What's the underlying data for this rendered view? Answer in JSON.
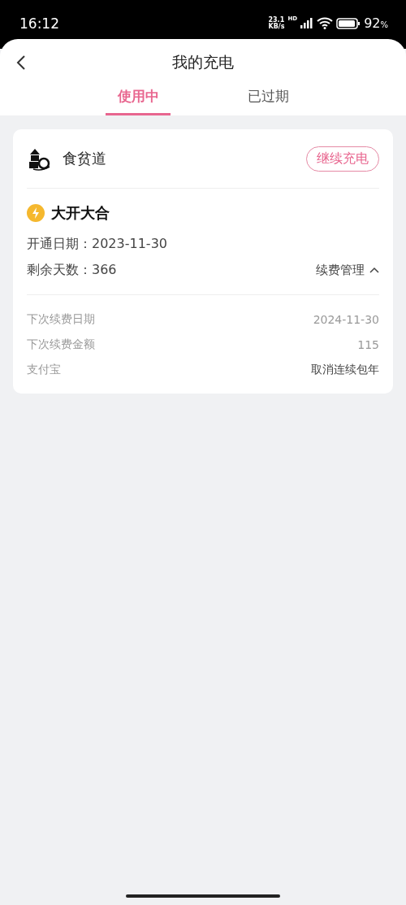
{
  "status_bar": {
    "time": "16:12",
    "net_speed": "23.1",
    "net_unit": "KB/s",
    "network": "HD",
    "battery": "92",
    "battery_unit": "%"
  },
  "header": {
    "title": "我的充电"
  },
  "tabs": [
    {
      "label": "使用中",
      "selected": true
    },
    {
      "label": "已过期",
      "selected": false
    }
  ],
  "card": {
    "creator": "食贫道",
    "action": "继续充电",
    "plan": "大开大合",
    "start_label": "开通日期：",
    "start_date": "2023-11-30",
    "days_label": "剩余天数：",
    "days": "366",
    "manage": {
      "label": "续费管理",
      "expanded": true
    },
    "details": [
      {
        "label": "下次续费日期",
        "value": "2024-11-30",
        "kind": "text"
      },
      {
        "label": "下次续费金额",
        "value": "115",
        "kind": "text"
      },
      {
        "label": "支付宝",
        "value": "取消连续包年",
        "kind": "link"
      }
    ]
  }
}
